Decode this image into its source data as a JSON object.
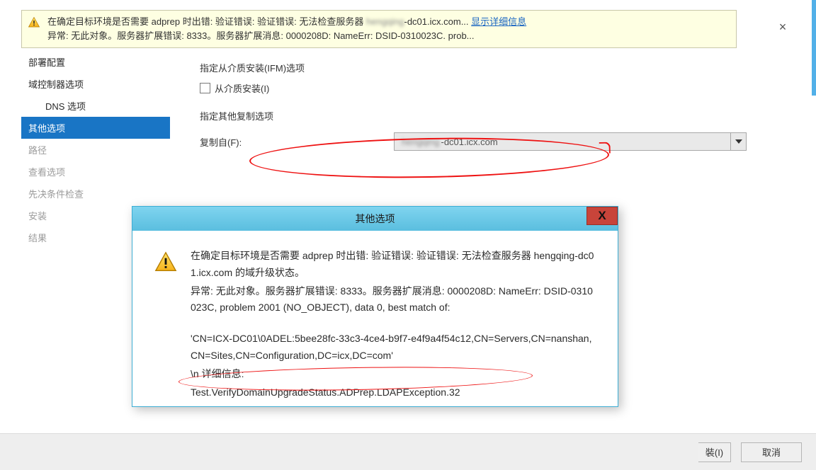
{
  "banner": {
    "line1_a": "在确定目标环境是否需要 adprep 时出错: 验证错误: 验证错误: 无法检查服务器",
    "line1_blur": "hengqing",
    "line1_b": "-dc01.icx.com...",
    "show_details": "显示详细信息",
    "line2": "异常: 无此对象。服务器扩展错误: 8333。服务器扩展消息: 0000208D: NameErr: DSID-0310023C. prob...",
    "close": "×"
  },
  "sidebar": {
    "items": [
      {
        "label": "部署配置",
        "cls": ""
      },
      {
        "label": "域控制器选项",
        "cls": ""
      },
      {
        "label": "DNS 选项",
        "cls": "sub"
      },
      {
        "label": "其他选项",
        "cls": "selected"
      },
      {
        "label": "路径",
        "cls": "dim"
      },
      {
        "label": "查看选项",
        "cls": "dim"
      },
      {
        "label": "先决条件检查",
        "cls": "dim"
      },
      {
        "label": "安装",
        "cls": "dim"
      },
      {
        "label": "结果",
        "cls": "dim"
      }
    ]
  },
  "main": {
    "ifm_title": "指定从介质安装(IFM)选项",
    "ifm_checkbox": "从介质安装(I)",
    "repl_title": "指定其他复制选项",
    "repl_label": "复制自(F):",
    "repl_value_blur": "hengqing",
    "repl_value_tail": "-dc01.icx.com"
  },
  "dialog": {
    "title": "其他选项",
    "p1": "在确定目标环境是否需要 adprep 时出错: 验证错误: 验证错误: 无法检查服务器 hengqing-dc01.icx.com 的域升级状态。",
    "p2": "异常: 无此对象。服务器扩展错误: 8333。服务器扩展消息: 0000208D: NameErr: DSID-0310023C, problem 2001 (NO_OBJECT), data 0, best match of:",
    "p3": "'CN=ICX-DC01\\0ADEL:5bee28fc-33c3-4ce4-b9f7-e4f9a4f54c12,CN=Servers,CN=nanshan,CN=Sites,CN=Configuration,DC=icx,DC=com'",
    "p4": "\\n 详细信息:",
    "p5": "Test.VerifyDomainUpgradeStatus.ADPrep.LDAPException.32"
  },
  "footer": {
    "install_frag": "裝(I)",
    "cancel": "取消"
  }
}
